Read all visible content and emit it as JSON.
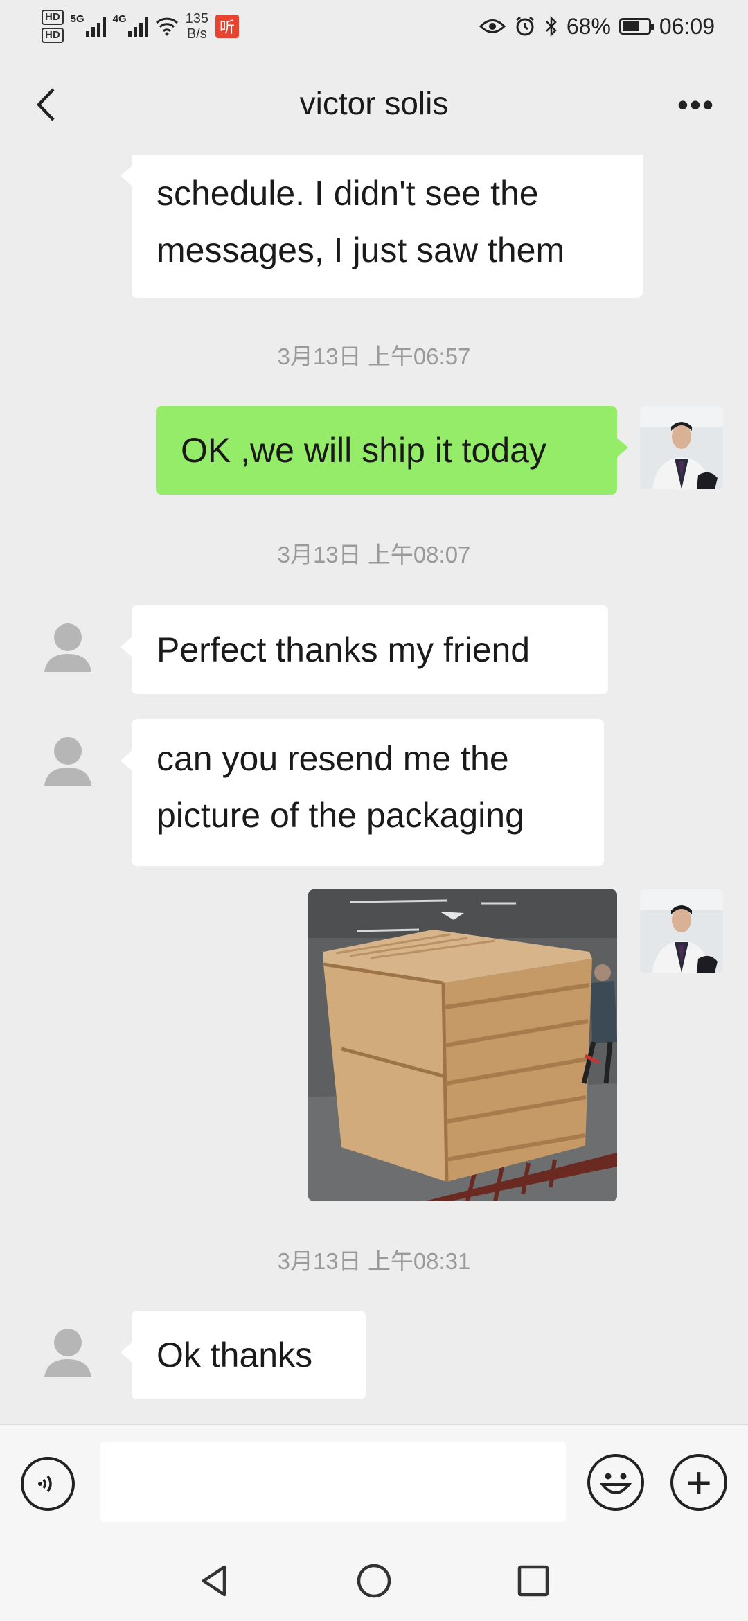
{
  "status_bar": {
    "hd1": "HD",
    "hd2": "HD",
    "sig1_gen": "5G",
    "sig2_gen": "4G",
    "rate_value": "135",
    "rate_unit": "B/s",
    "app_badge": "听",
    "battery_percent": "68%",
    "battery_level": 0.68,
    "time": "06:09"
  },
  "header": {
    "back_icon": "chevron-left-icon",
    "title": "victor solis",
    "more_label": "•••"
  },
  "messages": [
    {
      "side": "in",
      "text_lines": [
        "schedule.  I didn't see the",
        "messages, I just saw them"
      ]
    },
    {
      "timestamp": "3月13日 上午06:57"
    },
    {
      "side": "out",
      "text": "OK ,we will ship it today"
    },
    {
      "timestamp": "3月13日 上午08:07"
    },
    {
      "side": "in",
      "text": "Perfect thanks my friend"
    },
    {
      "side": "in",
      "text_lines": [
        "can you resend me the",
        "picture of the packaging"
      ]
    },
    {
      "side": "out",
      "type": "image",
      "content": "wooden-crate-photo"
    },
    {
      "timestamp": "3月13日 上午08:31"
    },
    {
      "side": "in",
      "text": "Ok thanks"
    }
  ],
  "input_bar": {
    "voice_icon": "voice-icon",
    "text_value": "",
    "emoji_icon": "emoji-icon",
    "plus_label": "+"
  },
  "nav_bar": {
    "back_icon": "triangle-back-icon",
    "home_icon": "circle-home-icon",
    "recents_icon": "square-recents-icon"
  },
  "colors": {
    "background": "#ededed",
    "outgoing_bubble": "#95ec69",
    "incoming_bubble": "#ffffff",
    "timestamp": "#9a9a9a"
  }
}
